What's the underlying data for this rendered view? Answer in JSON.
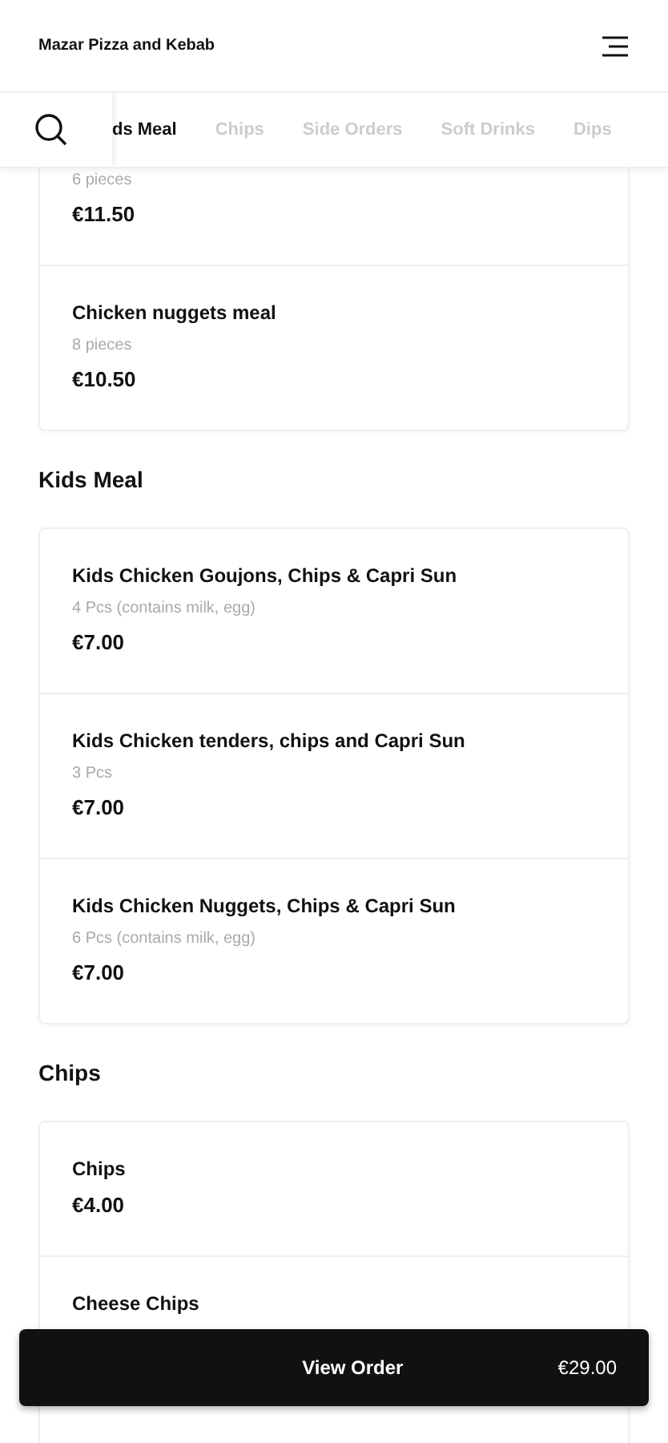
{
  "header": {
    "title": "Mazar Pizza and Kebab"
  },
  "category_tabs": [
    {
      "label": "ds Meal",
      "selected": true
    },
    {
      "label": "Chips",
      "selected": false
    },
    {
      "label": "Side Orders",
      "selected": false
    },
    {
      "label": "Soft Drinks",
      "selected": false
    },
    {
      "label": "Dips",
      "selected": false
    }
  ],
  "sections": [
    {
      "items": [
        {
          "description": "6 pieces",
          "price": "€11.50"
        },
        {
          "name": "Chicken nuggets meal",
          "description": "8 pieces",
          "price": "€10.50"
        }
      ]
    },
    {
      "heading": "Kids Meal",
      "items": [
        {
          "name": "Kids Chicken Goujons, Chips & Capri Sun",
          "description": "4 Pcs (contains milk, egg)",
          "price": "€7.00"
        },
        {
          "name": "Kids Chicken tenders, chips and Capri Sun",
          "description": "3 Pcs",
          "price": "€7.00"
        },
        {
          "name": "Kids Chicken Nuggets, Chips & Capri Sun",
          "description": "6 Pcs (contains milk, egg)",
          "price": "€7.00"
        }
      ]
    },
    {
      "heading": "Chips",
      "items": [
        {
          "name": "Chips",
          "price": "€4.00"
        },
        {
          "name": "Cheese Chips"
        }
      ]
    }
  ],
  "order_bar": {
    "label": "View Order",
    "total": "€29.00"
  }
}
